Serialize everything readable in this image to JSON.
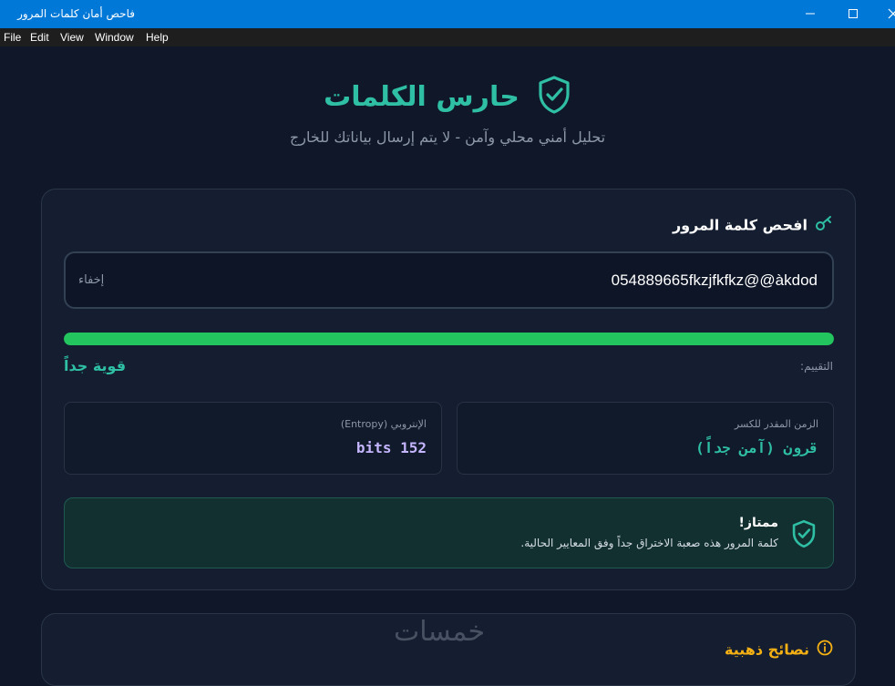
{
  "window": {
    "title": "فاحص أمان كلمات المرور",
    "controls": {
      "minimize": "minimize-icon",
      "maximize": "maximize-icon",
      "close": "close-icon"
    }
  },
  "menu": {
    "file": "File",
    "edit": "Edit",
    "view": "View",
    "window": "Window",
    "help": "Help"
  },
  "header": {
    "title": "حارس الكلمات",
    "icon": "shield-check-icon",
    "subtitle": "تحليل أمني محلي وآمن - لا يتم إرسال بياناتك للخارج"
  },
  "checker": {
    "heading": "افحص كلمة المرور",
    "heading_icon": "key-icon",
    "password_value": "054889665fkzjfkfkz@@àkdod",
    "toggle_label": "إخفاء",
    "strength_fraction": 1.0,
    "strength_color": "#22c55e",
    "rating_label": "التقييم:",
    "rating_value": "قوية جداً",
    "stats": {
      "crack_time_label": "الزمن المقدر للكسر",
      "crack_time_value": "قرون (آمن جداً)",
      "entropy_label": "الإنتروبي (Entropy)",
      "entropy_value": "152 bits"
    },
    "verdict": {
      "icon": "shield-check-icon",
      "title": "ممتاز!",
      "description": "كلمة المرور هذه صعبة الاختراق جداً وفق المعايير الحالية."
    }
  },
  "tips": {
    "heading": "نصائح ذهبية",
    "icon": "info-icon"
  },
  "watermark": "خمسات",
  "colors": {
    "accent": "#2ebfa5",
    "background": "#0f1729",
    "card": "#141e30",
    "strong": "#22c55e",
    "entropy": "#c4b5fd",
    "tips": "#f5b014"
  }
}
